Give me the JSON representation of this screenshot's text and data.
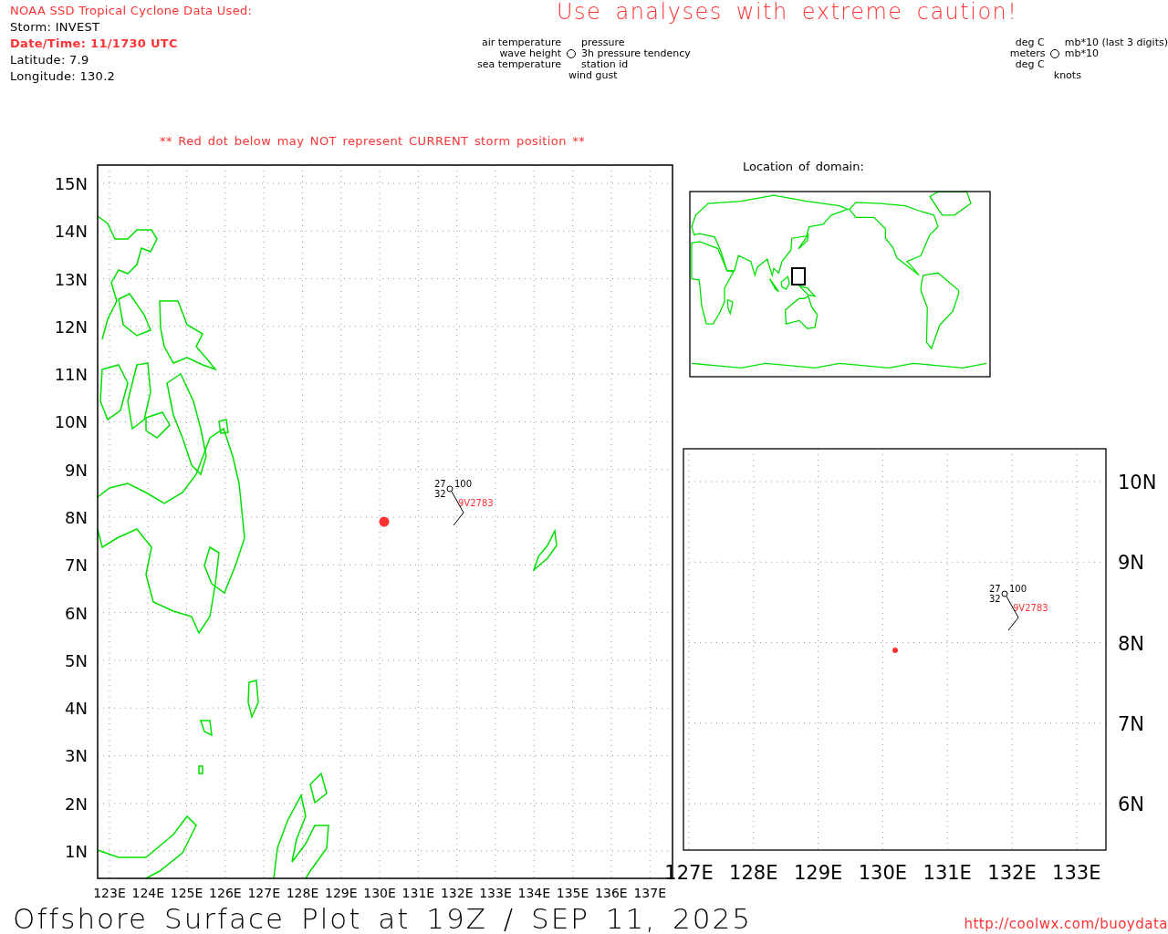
{
  "header": {
    "source_title": "NOAA SSD Tropical Cyclone Data Used:",
    "storm": "Storm: INVEST",
    "datetime": "Date/Time: 11/1730 UTC",
    "latitude": "Latitude: 7.9",
    "longitude": "Longitude: 130.2"
  },
  "caution": "Use analyses with extreme caution!",
  "station_legend": {
    "left": [
      "air temperature",
      "wave height",
      "sea temperature"
    ],
    "right": [
      "pressure",
      "3h pressure tendency",
      "station id"
    ],
    "bottom": "wind gust"
  },
  "units_legend": {
    "left": [
      "deg C",
      "meters",
      "deg C"
    ],
    "right": [
      "mb*10 (last 3 digits)",
      "mb*10"
    ],
    "bottom": "knots"
  },
  "warning": "** Red dot below may NOT represent CURRENT storm position **",
  "main_map": {
    "lat_labels": [
      "15N",
      "14N",
      "13N",
      "12N",
      "11N",
      "10N",
      "9N",
      "8N",
      "7N",
      "6N",
      "5N",
      "4N",
      "3N",
      "2N",
      "1N"
    ],
    "lon_labels": [
      "123E",
      "124E",
      "125E",
      "126E",
      "127E",
      "128E",
      "129E",
      "130E",
      "131E",
      "132E",
      "133E",
      "134E",
      "135E",
      "136E",
      "137E"
    ],
    "station": {
      "air_temperature": "27",
      "sea_temperature": "32",
      "pressure": "100",
      "station_id": "9V2783"
    }
  },
  "domain_map": {
    "title": "Location of domain:"
  },
  "zoom_map": {
    "lat_labels": [
      "10N",
      "9N",
      "8N",
      "7N",
      "6N"
    ],
    "lon_labels": [
      "127E",
      "128E",
      "129E",
      "130E",
      "131E",
      "132E",
      "133E"
    ],
    "station": {
      "air_temperature": "27",
      "sea_temperature": "32",
      "pressure": "100",
      "station_id": "9V2783"
    }
  },
  "footer": {
    "title": "Offshore Surface Plot at 19Z / SEP 11, 2025",
    "url": "http://coolwx.com/buoydata"
  }
}
